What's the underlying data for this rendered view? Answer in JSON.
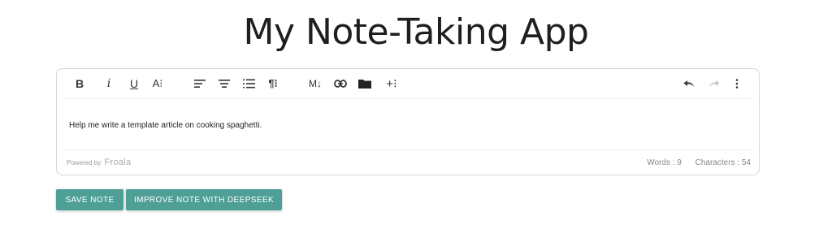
{
  "page": {
    "title": "My Note-Taking App"
  },
  "editor": {
    "toolbar": {
      "bold": "B",
      "italic": "i",
      "underline": "U",
      "font_size": "A⁝",
      "paragraph_format": "¶⁝",
      "markdown": "M↓",
      "more": "+⁝",
      "icons": [
        "align-left-icon",
        "align-center-icon",
        "ordered-list-icon",
        "link-icon",
        "folder-icon",
        "undo-icon",
        "redo-icon",
        "more-vertical-icon"
      ]
    },
    "content_text": "Help me write a template article on cooking spaghetti.",
    "footer": {
      "powered_prefix": "Powered by",
      "powered_brand": "Froala",
      "words": "Words : 9",
      "characters": "Characters : 54"
    }
  },
  "actions": {
    "save_label": "Save Note",
    "improve_label": "Improve Note with DeepSeek"
  },
  "colors": {
    "button": "#4e9f96",
    "border": "#d6d6d6"
  }
}
